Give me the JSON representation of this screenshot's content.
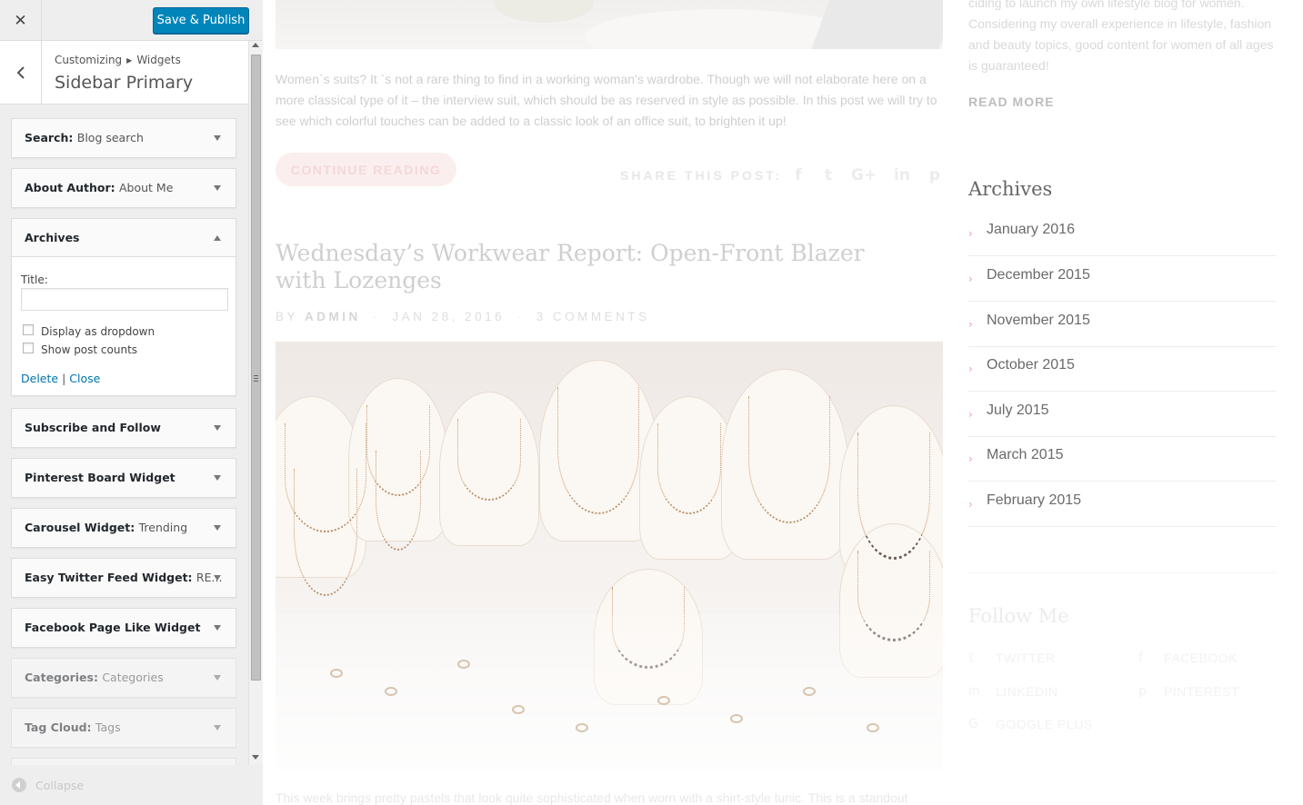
{
  "customizer": {
    "publish_label": "Save & Publish",
    "breadcrumb_root": "Customizing",
    "breadcrumb_current": "Widgets",
    "section_title": "Sidebar Primary",
    "collapse_label": "Collapse",
    "widgets": [
      {
        "name": "Search:",
        "sub": "Blog search",
        "state": "closed"
      },
      {
        "name": "About Author:",
        "sub": "About Me",
        "state": "closed"
      },
      {
        "name": "Archives",
        "sub": "",
        "state": "open"
      },
      {
        "name": "Subscribe and Follow",
        "sub": "",
        "state": "closed"
      },
      {
        "name": "Pinterest Board Widget",
        "sub": "",
        "state": "closed"
      },
      {
        "name": "Carousel Widget:",
        "sub": "Trending",
        "state": "closed"
      },
      {
        "name": "Easy Twitter Feed Widget:",
        "sub": "RE...",
        "state": "closed"
      },
      {
        "name": "Facebook Page Like Widget",
        "sub": "",
        "state": "closed"
      },
      {
        "name": "Categories:",
        "sub": "Categories",
        "state": "faded"
      },
      {
        "name": "Tag Cloud:",
        "sub": "Tags",
        "state": "faded"
      }
    ],
    "archives_form": {
      "title_label": "Title:",
      "title_value": "",
      "dropdown_label": "Display as dropdown",
      "dropdown_checked": false,
      "counts_label": "Show post counts",
      "counts_checked": false,
      "delete_label": "Delete",
      "separator": "|",
      "close_label": "Close"
    }
  },
  "preview": {
    "excerpt": "Women`s suits? It `s not a rare thing to find in a working woman's wardrobe. Though we will not elaborate here on a more classical type of it – the interview suit, which should be as reserved in style as possible. In this post we will try to see which colorful touches can be added to a classic look of an office suit, to brighten it up!",
    "continue_label": "CONTINUE READING",
    "share_label": "SHARE THIS POST:",
    "share_icons": [
      "f",
      "t",
      "G+",
      "in",
      "p"
    ],
    "post_title": "Wednesday’s Workwear Report: Open-Front Blazer with Lozenges",
    "meta_by": "BY",
    "meta_author": "ADMIN",
    "meta_date": "JAN 28, 2016",
    "meta_comments": "3 COMMENTS",
    "bottom_text": "This week brings pretty pastels that look quite sophisticated when worn with a shirt-style tunic. This is a standout",
    "about_text": "ciding to launch my own lifestyle blog for women. Considering my overall experience in lifestyle, fashion and beauty topics, good content for women of all ages is guaranteed!",
    "read_more": "READ MORE",
    "archives_title": "Archives",
    "archives": [
      "January 2016",
      "December 2015",
      "November 2015",
      "October 2015",
      "July 2015",
      "March 2015",
      "February 2015"
    ],
    "follow_title": "Follow Me",
    "follow_links": [
      "TWITTER",
      "FACEBOOK",
      "LINKEDIN",
      "PINTEREST",
      "GOOGLE PLUS"
    ]
  },
  "colors": {
    "publish_button": "#0085ba",
    "link": "#0073aa",
    "archive_chevron": "#e8a0a8"
  }
}
